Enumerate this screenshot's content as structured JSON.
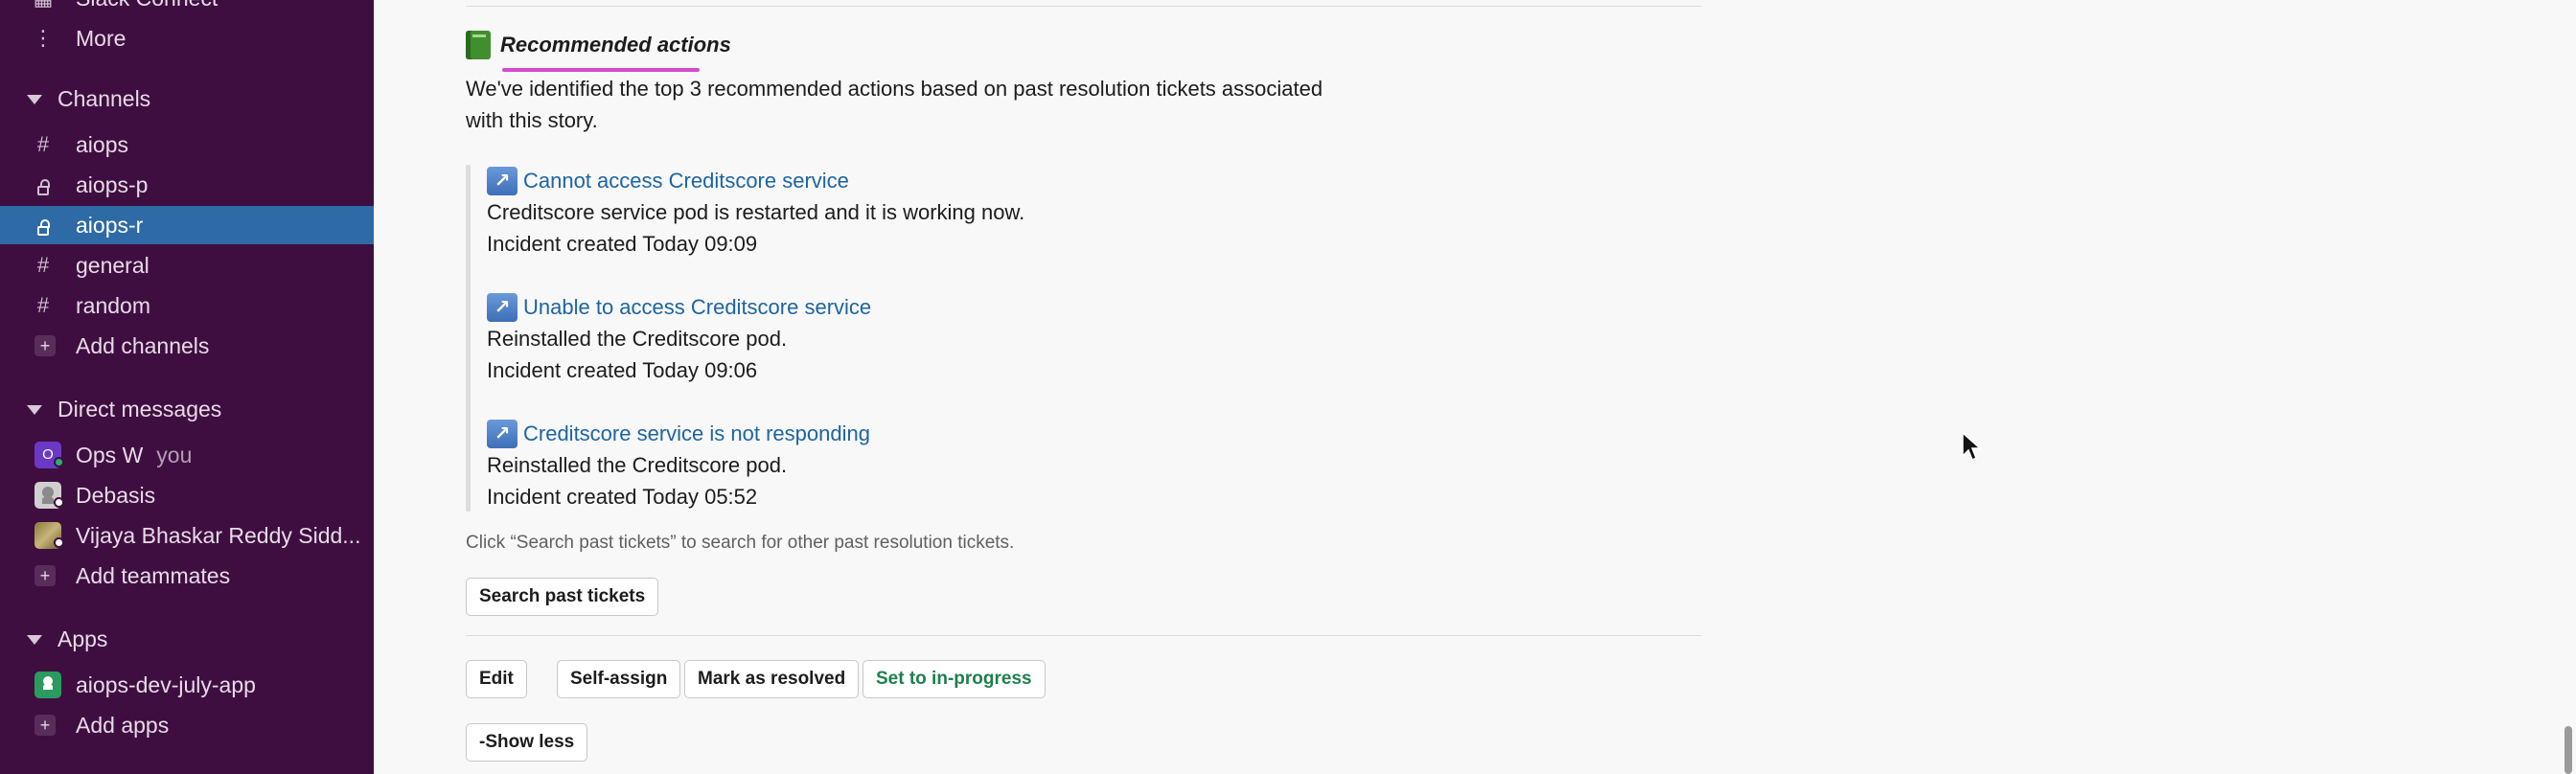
{
  "sidebar": {
    "more": "More",
    "top_cut": "Slack Connect",
    "channels_header": "Channels",
    "channels": [
      {
        "name": "aiops",
        "type": "public"
      },
      {
        "name": "aiops-p",
        "type": "private"
      },
      {
        "name": "aiops-r",
        "type": "private",
        "selected": true
      },
      {
        "name": "general",
        "type": "public"
      },
      {
        "name": "random",
        "type": "public"
      }
    ],
    "add_channels": "Add channels",
    "dm_header": "Direct messages",
    "dms": [
      {
        "name": "Ops W",
        "suffix": "you",
        "avatar_letter": "O"
      },
      {
        "name": "Debasis"
      },
      {
        "name": "Vijaya Bhaskar Reddy Sidd..."
      }
    ],
    "add_teammates": "Add teammates",
    "apps_header": "Apps",
    "apps": [
      {
        "name": "aiops-dev-july-app"
      }
    ],
    "add_apps": "Add apps",
    "hash": "#",
    "plus": "+"
  },
  "message": {
    "heading": "Recommended actions",
    "intro": "We've identified the top 3 recommended actions based on past resolution tickets associated with this story.",
    "arrow_glyph": "↗",
    "tickets": [
      {
        "title": "Cannot access Creditscore service",
        "resolution": "Creditscore service pod is restarted and it is working now.",
        "created": "Incident created Today 09:09"
      },
      {
        "title": "Unable to access Creditscore service",
        "resolution": "Reinstalled the Creditscore pod.",
        "created": "Incident created Today 09:06"
      },
      {
        "title": "Creditscore service is not responding",
        "resolution": "Reinstalled the Creditscore pod.",
        "created": "Incident created Today 05:52"
      }
    ],
    "hint": "Click “Search past tickets” to search for other past resolution tickets.",
    "search_button": "Search past tickets",
    "actions": {
      "edit": "Edit",
      "self_assign": "Self-assign",
      "mark_resolved": "Mark as resolved",
      "set_in_progress": "Set to in-progress"
    },
    "show_less": "-Show less"
  }
}
